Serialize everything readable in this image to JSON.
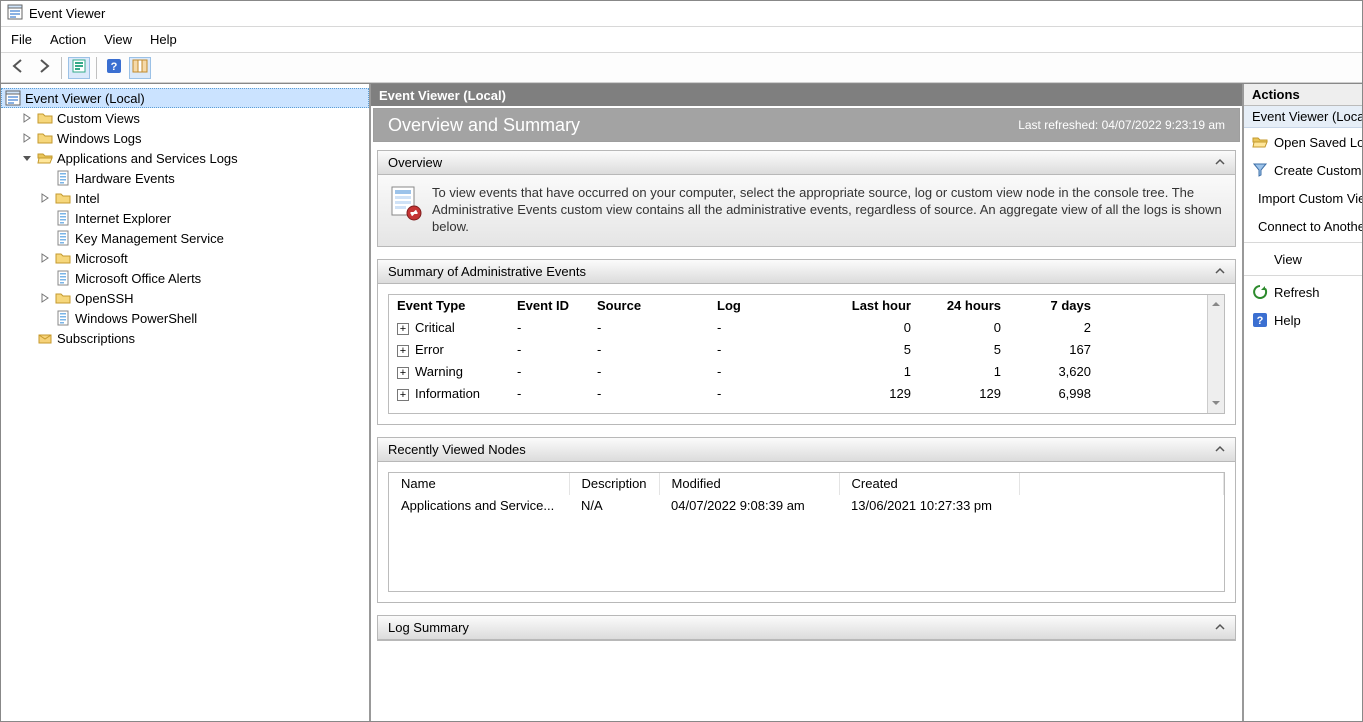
{
  "titlebar": {
    "app_title": "Event Viewer"
  },
  "menubar": {
    "file": "File",
    "action": "Action",
    "view": "View",
    "help": "Help"
  },
  "tree": {
    "root": "Event Viewer (Local)",
    "custom_views": "Custom Views",
    "windows_logs": "Windows Logs",
    "apps_services": "Applications and Services Logs",
    "hardware_events": "Hardware Events",
    "intel": "Intel",
    "internet_explorer": "Internet Explorer",
    "key_mgmt": "Key Management Service",
    "microsoft": "Microsoft",
    "office_alerts": "Microsoft Office Alerts",
    "openssh": "OpenSSH",
    "powershell": "Windows PowerShell",
    "subscriptions": "Subscriptions"
  },
  "center": {
    "header": "Event Viewer (Local)",
    "summary_title": "Overview and Summary",
    "refresh_label": "Last refreshed: 04/07/2022 9:23:19 am",
    "overview": {
      "title": "Overview",
      "text": "To view events that have occurred on your computer, select the appropriate source, log or custom view node in the console tree. The Administrative Events custom view contains all the administrative events, regardless of source. An aggregate view of all the logs is shown below."
    },
    "admin_summary": {
      "title": "Summary of Administrative Events",
      "headers": {
        "type": "Event Type",
        "id": "Event ID",
        "source": "Source",
        "log": "Log",
        "last_hour": "Last hour",
        "h24": "24 hours",
        "d7": "7 days"
      },
      "rows": [
        {
          "type": "Critical",
          "id": "-",
          "source": "-",
          "log": "-",
          "last_hour": "0",
          "h24": "0",
          "d7": "2"
        },
        {
          "type": "Error",
          "id": "-",
          "source": "-",
          "log": "-",
          "last_hour": "5",
          "h24": "5",
          "d7": "167"
        },
        {
          "type": "Warning",
          "id": "-",
          "source": "-",
          "log": "-",
          "last_hour": "1",
          "h24": "1",
          "d7": "3,620"
        },
        {
          "type": "Information",
          "id": "-",
          "source": "-",
          "log": "-",
          "last_hour": "129",
          "h24": "129",
          "d7": "6,998"
        }
      ]
    },
    "recent": {
      "title": "Recently Viewed Nodes",
      "headers": {
        "name": "Name",
        "description": "Description",
        "modified": "Modified",
        "created": "Created"
      },
      "rows": [
        {
          "name": "Applications and Service...",
          "description": "N/A",
          "modified": "04/07/2022 9:08:39 am",
          "created": "13/06/2021 10:27:33 pm"
        }
      ]
    },
    "log_summary_title": "Log Summary"
  },
  "actions": {
    "title": "Actions",
    "context": "Event Viewer (Local)",
    "open_saved": "Open Saved Log...",
    "create_custom": "Create Custom View...",
    "import_custom": "Import Custom View...",
    "connect": "Connect to Another Computer...",
    "view": "View",
    "refresh": "Refresh",
    "help": "Help"
  }
}
